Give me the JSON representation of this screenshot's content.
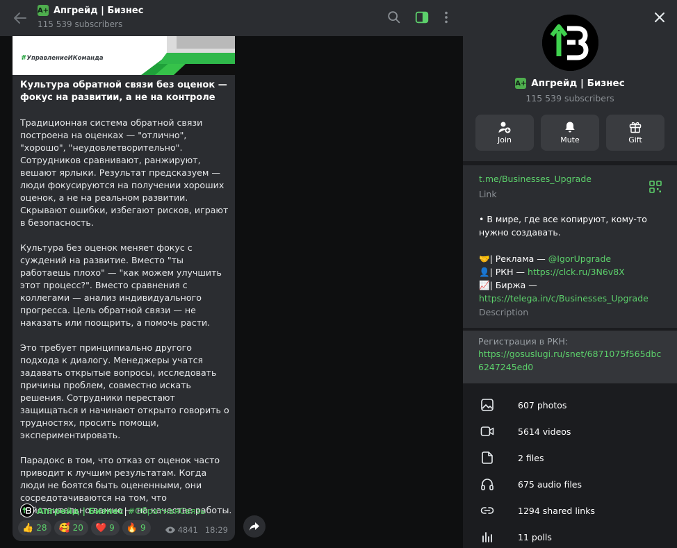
{
  "chat": {
    "header": {
      "title": "Апгрейд | Бизнес",
      "subscribers": "115 539 subscribers",
      "badge": "A+"
    },
    "post": {
      "image_tag": "УправлениеИКоманда",
      "title": "Культура обратной связи без оценок — фокус на развитии, а не на контроле",
      "paragraphs": [
        "Традиционная система обратной связи построена на оценках — \"отлично\", \"хорошо\", \"неудовлетворительно\". Сотрудников сравнивают, ранжируют, вешают ярлыки. Результат предсказуем — люди фокусируются на получении хороших оценок, а не на реальном развитии. Скрывают ошибки, избегают рисков, играют в безопасность.",
        "Культура без оценок меняет фокус с суждений на развитие. Вместо \"ты работаешь плохо\" — \"как можем улучшить этот процесс?\". Вместо сравнения с коллегами — анализ индивидуального прогресса. Цель обратной связи — не наказать или поощрить, а помочь расти.",
        "Это требует принципиально другого подхода к диалогу. Менеджеры учатся задавать открытые вопросы, исследовать причины проблем, совместно искать решения. Сотрудники перестают защищаться и начинают открыто говорить о трудностях, просить помощи, экспериментировать.",
        "Парадокс в том, что отказ от оценок часто приводит к лучшим результатам. Когда люди не боятся быть оцененными, они сосредотачиваются на том, что действительно важно — на качестве работы."
      ],
      "signature_name": "Апгрейд | Бизнес",
      "signature_sep": "|",
      "signature_tag": "#ОбратнаяСвязь",
      "reactions": [
        {
          "emoji": "👍",
          "count": "28"
        },
        {
          "emoji": "🥰",
          "count": "20"
        },
        {
          "emoji": "❤️",
          "count": "9"
        },
        {
          "emoji": "🔥",
          "count": "9"
        }
      ],
      "views": "4841",
      "time": "18:29"
    }
  },
  "info": {
    "name": "Апгрейд | Бизнес",
    "subscribers": "115 539 subscribers",
    "actions": [
      {
        "label": "Join",
        "icon": "add-user-icon"
      },
      {
        "label": "Mute",
        "icon": "bell-icon"
      },
      {
        "label": "Gift",
        "icon": "gift-icon"
      }
    ],
    "link": "t.me/Businesses_Upgrade",
    "link_label": "Link",
    "desc_line1": "• В мире, где все копируют, кому-то нужно создавать.",
    "desc_ads_emoji": "🤝",
    "desc_ads_text": "| Реклама — ",
    "desc_ads_link": "@IgorUpgrade",
    "desc_rkn_emoji": "👤",
    "desc_rkn_text": "| РКН — ",
    "desc_rkn_link": "https://clck.ru/3N6v8X",
    "desc_exch_emoji": "📈",
    "desc_exch_text": "| Биржа —",
    "desc_exch_link": "https://telega.in/c/Businesses_Upgrade",
    "desc_label": "Description",
    "reg_label": "Регистрация в РКН:",
    "reg_link": "https://gosuslugi.ru/snet/6871075f565dbc6247245ed0",
    "media": [
      {
        "label": "607 photos",
        "icon": "photo-icon"
      },
      {
        "label": "5614 videos",
        "icon": "video-icon"
      },
      {
        "label": "2 files",
        "icon": "file-icon"
      },
      {
        "label": "675 audio files",
        "icon": "headphones-icon"
      },
      {
        "label": "1294 shared links",
        "icon": "link-icon"
      },
      {
        "label": "11 polls",
        "icon": "poll-icon"
      }
    ]
  },
  "colors": {
    "accent": "#5cd06b",
    "panel": "#2b2d31",
    "background": "#0e0f10"
  }
}
